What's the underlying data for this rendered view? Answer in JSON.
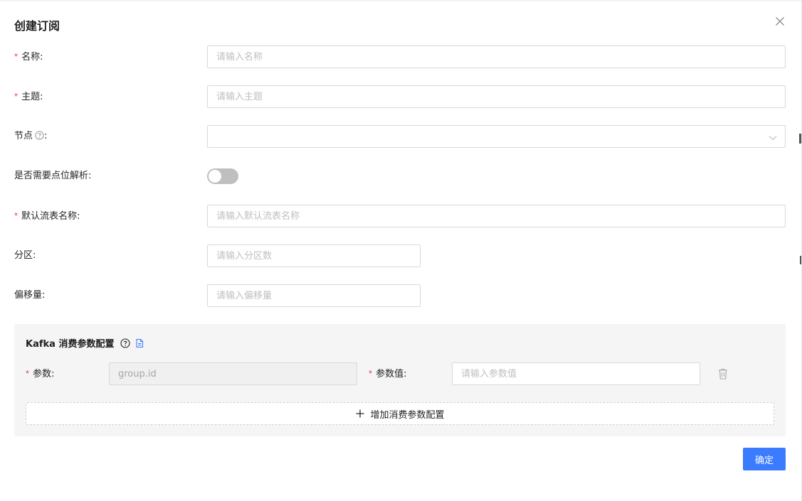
{
  "modal": {
    "title": "创建订阅",
    "confirm_label": "确定"
  },
  "form": {
    "name": {
      "label": "名称",
      "required": true,
      "placeholder": "请输入名称",
      "value": ""
    },
    "topic": {
      "label": "主题",
      "required": true,
      "placeholder": "请输入主题",
      "value": ""
    },
    "node": {
      "label": "节点",
      "required": false,
      "selected": ""
    },
    "point_parse": {
      "label": "是否需要点位解析",
      "enabled": false
    },
    "default_stream_table": {
      "label": "默认流表名称",
      "required": true,
      "placeholder": "请输入默认流表名称",
      "value": ""
    },
    "partition": {
      "label": "分区",
      "required": false,
      "placeholder": "请输入分区数",
      "value": ""
    },
    "offset": {
      "label": "偏移量",
      "required": false,
      "placeholder": "请输入偏移量",
      "value": ""
    },
    "colon": ":"
  },
  "kafka": {
    "title": "Kafka 消费参数配置",
    "params": [
      {
        "param_label": "参数",
        "param_value": "group.id",
        "value_label": "参数值",
        "value_placeholder": "请输入参数值",
        "value": ""
      }
    ],
    "add_label": "增加消费参数配置"
  },
  "colors": {
    "primary": "#3b7cff",
    "required": "#e5484d",
    "panel_bg": "#f5f5f6"
  },
  "icons": [
    "close-icon",
    "help-icon",
    "chevron-down-icon",
    "document-icon",
    "trash-icon",
    "plus-icon"
  ]
}
